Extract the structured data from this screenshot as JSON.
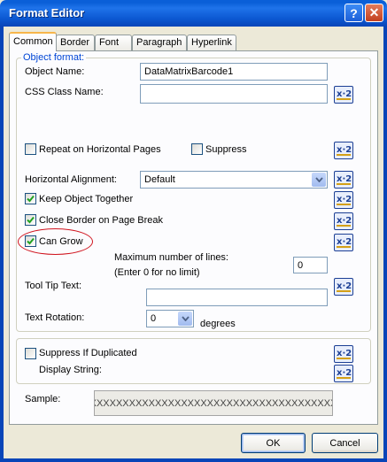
{
  "window": {
    "title": "Format Editor",
    "help_label": "?",
    "close_label": "✕"
  },
  "tabs": [
    {
      "label": "Common",
      "active": true
    },
    {
      "label": "Border",
      "active": false
    },
    {
      "label": "Font",
      "active": false
    },
    {
      "label": "Paragraph",
      "active": false
    },
    {
      "label": "Hyperlink",
      "active": false
    }
  ],
  "object_format": {
    "legend": "Object format:",
    "object_name_label": "Object Name:",
    "object_name_value": "DataMatrixBarcode1",
    "css_class_label": "CSS Class Name:",
    "css_class_value": "",
    "repeat_label": "Repeat on Horizontal Pages",
    "repeat_checked": false,
    "suppress_label": "Suppress",
    "suppress_checked": false,
    "horizontal_alignment_label": "Horizontal Alignment:",
    "horizontal_alignment_value": "Default",
    "keep_together_label": "Keep Object Together",
    "keep_together_checked": true,
    "close_border_label": "Close Border on Page Break",
    "close_border_checked": true,
    "can_grow_label": "Can Grow",
    "can_grow_checked": true,
    "max_lines_label": "Maximum number of lines:",
    "max_lines_hint": "(Enter 0 for no limit)",
    "max_lines_value": "0",
    "tooltip_label": "Tool Tip Text:",
    "tooltip_value": "",
    "rotation_label": "Text Rotation:",
    "rotation_value": "0",
    "rotation_unit": "degrees"
  },
  "duplicates": {
    "suppress_dup_label": "Suppress If Duplicated",
    "suppress_dup_checked": false,
    "display_string_label": "Display String:"
  },
  "sample": {
    "label": "Sample:",
    "value": "XXXXXXXXXXXXXXXXXXXXXXXXXXXXXXXXXXXXXXXX"
  },
  "buttons": {
    "ok": "OK",
    "cancel": "Cancel"
  },
  "formula_icon": "formula-x2-icon",
  "colors": {
    "title_bar": "#0a5fd8",
    "group_legend": "#0046d5",
    "annotation_ellipse": "#d0141e",
    "check_mark": "#21a121"
  }
}
